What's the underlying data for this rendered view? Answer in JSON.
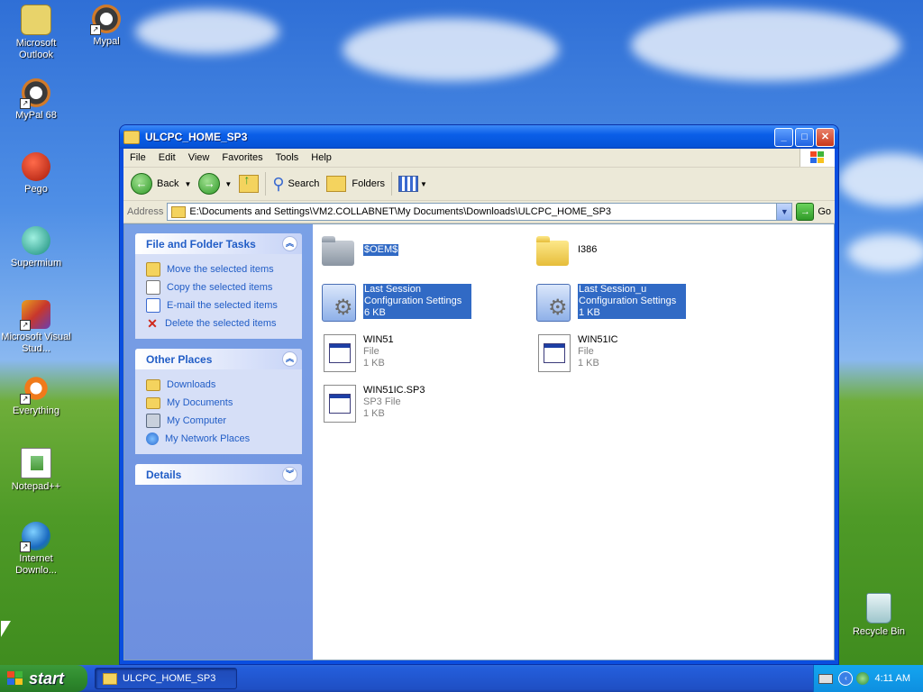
{
  "desktop": {
    "icons": [
      {
        "label": "Microsoft Outlook",
        "icon": "outlook-icon"
      },
      {
        "label": "Mypal",
        "icon": "mypal-icon"
      },
      {
        "label": "MyPal 68",
        "icon": "mypal-icon"
      },
      {
        "label": "Pego",
        "icon": "pego-icon"
      },
      {
        "label": "Supermium",
        "icon": "supermium-icon"
      },
      {
        "label": "Microsoft Visual Stud...",
        "icon": "visual-studio-icon"
      },
      {
        "label": "Everything",
        "icon": "everything-icon"
      },
      {
        "label": "Notepad++",
        "icon": "notepadpp-icon"
      },
      {
        "label": "Internet Downlo...",
        "icon": "idm-icon"
      },
      {
        "label": "Recycle Bin",
        "icon": "recycle-bin-icon"
      }
    ]
  },
  "window": {
    "title": "ULCPC_HOME_SP3",
    "menu": [
      "File",
      "Edit",
      "View",
      "Favorites",
      "Tools",
      "Help"
    ],
    "toolbar": {
      "back": "Back",
      "search": "Search",
      "folders": "Folders"
    },
    "address": {
      "label": "Address",
      "path": "E:\\Documents and Settings\\VM2.COLLABNET\\My Documents\\Downloads\\ULCPC_HOME_SP3",
      "go": "Go"
    },
    "tasks": {
      "file_folder_title": "File and Folder Tasks",
      "file_folder_items": [
        "Move the selected items",
        "Copy the selected items",
        "E-mail the selected items",
        "Delete the selected items"
      ],
      "other_places_title": "Other Places",
      "other_places_items": [
        "Downloads",
        "My Documents",
        "My Computer",
        "My Network Places"
      ],
      "details_title": "Details"
    },
    "files": [
      {
        "name": "$OEM$",
        "line2": "",
        "line3": "",
        "kind": "folder",
        "selected": true
      },
      {
        "name": "I386",
        "line2": "",
        "line3": "",
        "kind": "folder",
        "selected": false
      },
      {
        "name": "Last Session",
        "line2": "Configuration Settings",
        "line3": "6 KB",
        "kind": "config",
        "selected": true
      },
      {
        "name": "Last Session_u",
        "line2": "Configuration Settings",
        "line3": "1 KB",
        "kind": "config",
        "selected": true
      },
      {
        "name": "WIN51",
        "line2": "File",
        "line3": "1 KB",
        "kind": "file",
        "selected": false
      },
      {
        "name": "WIN51IC",
        "line2": "File",
        "line3": "1 KB",
        "kind": "file",
        "selected": false
      },
      {
        "name": "WIN51IC.SP3",
        "line2": "SP3 File",
        "line3": "1 KB",
        "kind": "file",
        "selected": false
      }
    ]
  },
  "taskbar": {
    "start": "start",
    "item": "ULCPC_HOME_SP3",
    "time": "4:11 AM"
  },
  "colors": {
    "selection": "#316ac5",
    "link": "#215dc6",
    "titlebar": "#0a5ee8"
  }
}
